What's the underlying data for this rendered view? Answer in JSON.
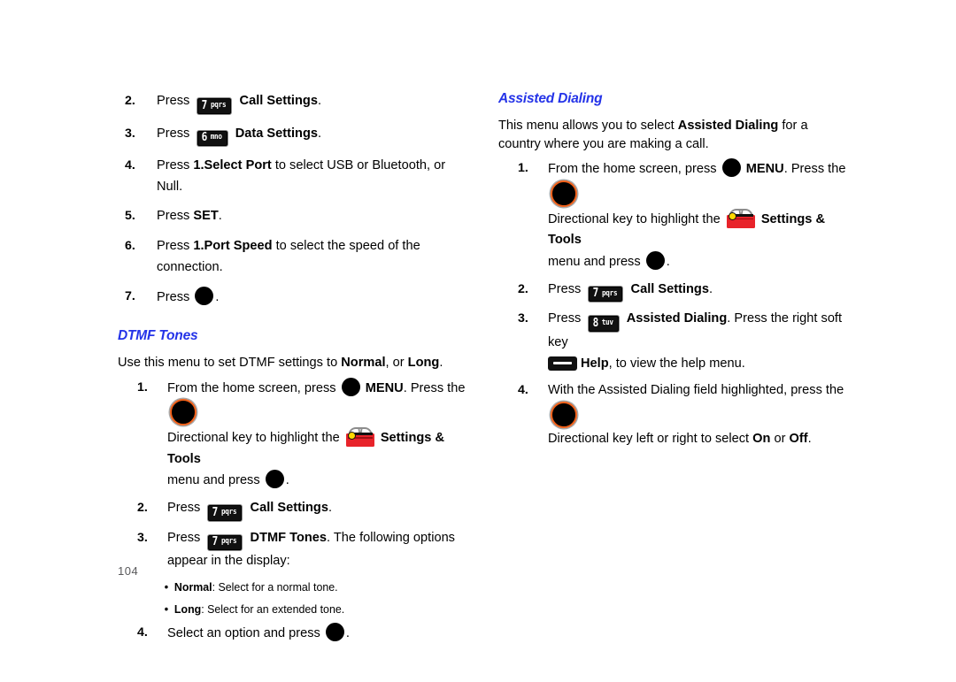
{
  "document": {
    "page_number": "104",
    "heading_color": "#2433e8",
    "toolbox_color": "#e8232a",
    "dirkey_ring_color": "#f2611a"
  },
  "icons": {
    "key7": {
      "digit": "7",
      "letters": "pqrs",
      "name": "key-7-pqrs"
    },
    "key6": {
      "digit": "6",
      "letters": "mno",
      "name": "key-6-mno"
    },
    "key8": {
      "digit": "8",
      "letters": "tuv",
      "name": "key-8-tuv"
    },
    "ok_key": "ok-key",
    "directional_key": "directional-key",
    "soft_key": "right-soft-key",
    "settings_tools": "settings-and-tools-toolbox"
  },
  "left_column": {
    "data_settings_steps": {
      "step2": {
        "num": "2.",
        "press": "Press",
        "bold": "Call Settings",
        "tail": "."
      },
      "step3": {
        "num": "3.",
        "press": "Press",
        "bold": "Data Settings",
        "tail": "."
      },
      "step4": {
        "num": "4.",
        "press": "Press ",
        "bold": "1.Select Port",
        "tail": " to select USB or Bluetooth, or Null."
      },
      "step5": {
        "num": "5.",
        "press": "Press ",
        "bold": "SET",
        "tail": "."
      },
      "step6": {
        "num": "6.",
        "press": "Press ",
        "bold": "1.Port Speed",
        "tail": " to select the speed of the connection."
      },
      "step7": {
        "num": "7.",
        "press": "Press",
        "tail": "."
      }
    },
    "dtmf": {
      "heading": "DTMF Tones",
      "intro_a": "Use this menu to set DTMF settings to ",
      "intro_b": "Normal",
      "intro_c": ", or ",
      "intro_d": "Long",
      "intro_e": ".",
      "step1": {
        "num": "1.",
        "a": "From the home screen, press",
        "b": "MENU",
        "c": ". Press the",
        "d": "Directional key to highlight the",
        "e": "Settings & Tools",
        "f": "menu and press",
        "g": "."
      },
      "step2": {
        "num": "2.",
        "press": "Press",
        "bold": "Call Settings",
        "tail": "."
      },
      "step3": {
        "num": "3.",
        "press": "Press",
        "bold": "DTMF Tones",
        "tail": ". The following options appear in the display:"
      },
      "options": [
        {
          "label": "Normal",
          "desc": ": Select for a normal tone."
        },
        {
          "label": "Long",
          "desc": ": Select for an extended tone."
        }
      ],
      "step4": {
        "num": "4.",
        "text": "Select an option and press",
        "tail": "."
      }
    }
  },
  "right_column": {
    "assisted_dialing": {
      "heading": "Assisted Dialing",
      "intro_a": "This menu allows you to select ",
      "intro_b": "Assisted Dialing",
      "intro_c": " for a country where you are making a call.",
      "step1": {
        "num": "1.",
        "a": "From the home screen, press",
        "b": "MENU",
        "c": ". Press the",
        "d": "Directional key to highlight the",
        "e": "Settings & Tools",
        "f": "menu and press",
        "g": "."
      },
      "step2": {
        "num": "2.",
        "press": "Press",
        "bold": "Call Settings",
        "tail": "."
      },
      "step3": {
        "num": "3.",
        "press": "Press",
        "bold": "Assisted Dialing",
        "mid": ". Press the right soft key",
        "help": "Help",
        "tail": ", to view the help menu."
      },
      "step4": {
        "num": "4.",
        "a": "With the Assisted Dialing field highlighted, press the",
        "b": "Directional key left or right to select ",
        "c": "On",
        "d": " or ",
        "e": "Off",
        "f": "."
      }
    }
  }
}
